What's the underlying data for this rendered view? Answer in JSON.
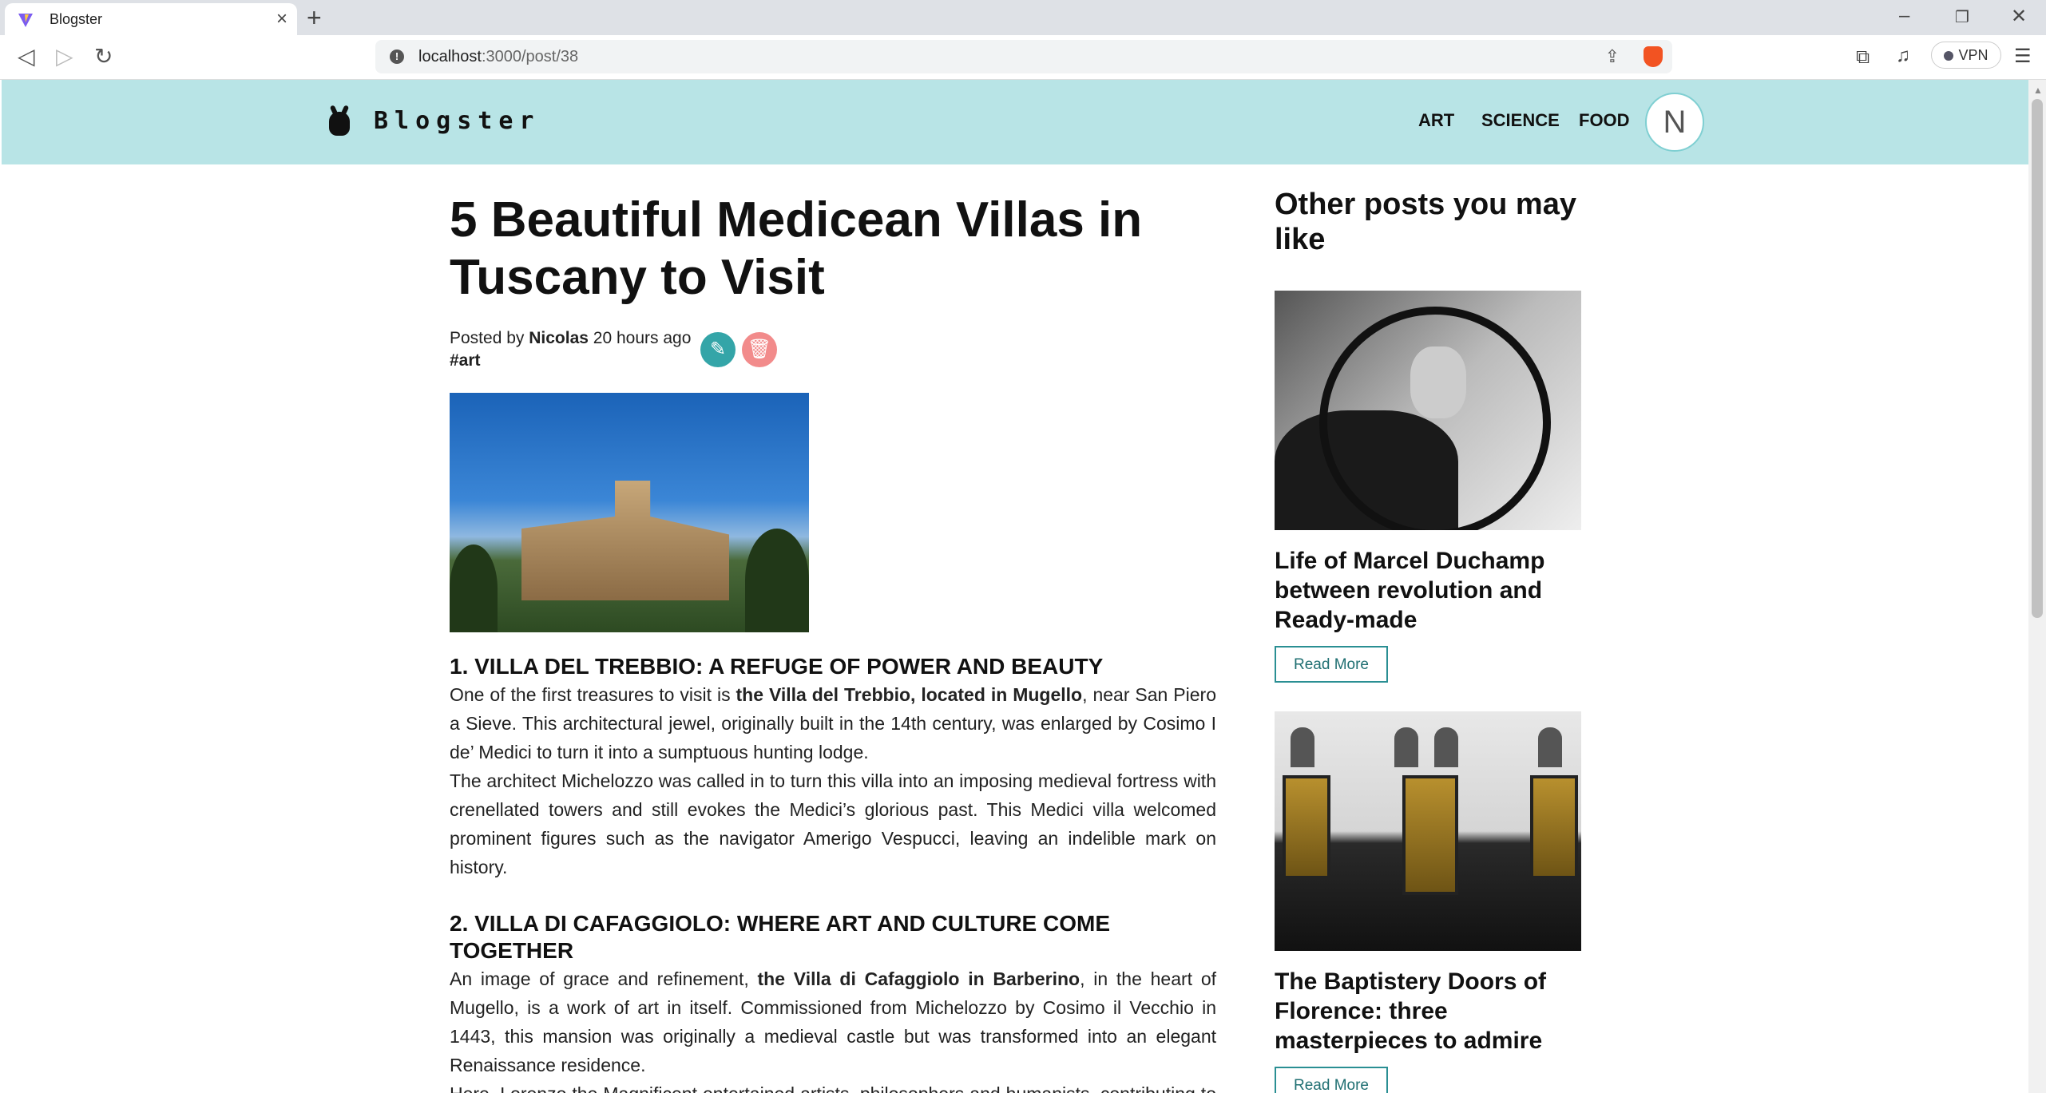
{
  "browser": {
    "tab_title": "Blogster",
    "url_host": "localhost",
    "url_path": ":3000/post/38",
    "vpn_label": "VPN"
  },
  "site": {
    "logo": "Blogster",
    "nav": [
      "ART",
      "SCIENCE",
      "FOOD"
    ],
    "avatar_initial": "N"
  },
  "article": {
    "title": "5 Beautiful Medicean Villas in Tuscany to Visit",
    "posted_by_prefix": "Posted by",
    "author": "Nicolas",
    "time": "20 hours ago",
    "tag": "#art",
    "sections": [
      {
        "heading": "1. VILLA DEL TREBBIO: A REFUGE OF POWER AND BEAUTY",
        "p1_pre": "One of the first treasures to visit is ",
        "p1_bold": "the Villa del Trebbio, located in Mugello",
        "p1_post": ", near San Piero a Sieve. This architectural jewel, originally built in the 14th century, was enlarged by Cosimo I de’ Medici to turn it into a sumptuous hunting lodge.",
        "p2": "The architect Michelozzo was called in to turn this villa into an imposing medieval fortress with crenellated towers and still evokes the Medici’s glorious past. This Medici villa welcomed prominent figures such as the navigator Amerigo Vespucci, leaving an indelible mark on history."
      },
      {
        "heading": "2. VILLA DI CAFAGGIOLO: WHERE ART AND CULTURE COME TOGETHER",
        "p1_pre": "An image of grace and refinement, ",
        "p1_bold": "the Villa di Cafaggiolo in Barberino",
        "p1_post": ", in the heart of Mugello, is a work of art in itself. Commissioned from Michelozzo by Cosimo il Vecchio in 1443, this mansion was originally a medieval castle but was transformed into an elegant Renaissance residence.",
        "p2": "Here, Lorenzo the Magnificent entertained artists, philosophers and humanists, contributing to the spread of culture and art. This villa is to wit..."
      }
    ]
  },
  "sidebar": {
    "heading": "Other posts you may like",
    "posts": [
      {
        "title": "Life of Marcel Duchamp between revolution and Ready-made",
        "button": "Read More"
      },
      {
        "title": "The Baptistery Doors of Florence: three masterpieces to admire",
        "button": "Read More"
      }
    ]
  }
}
